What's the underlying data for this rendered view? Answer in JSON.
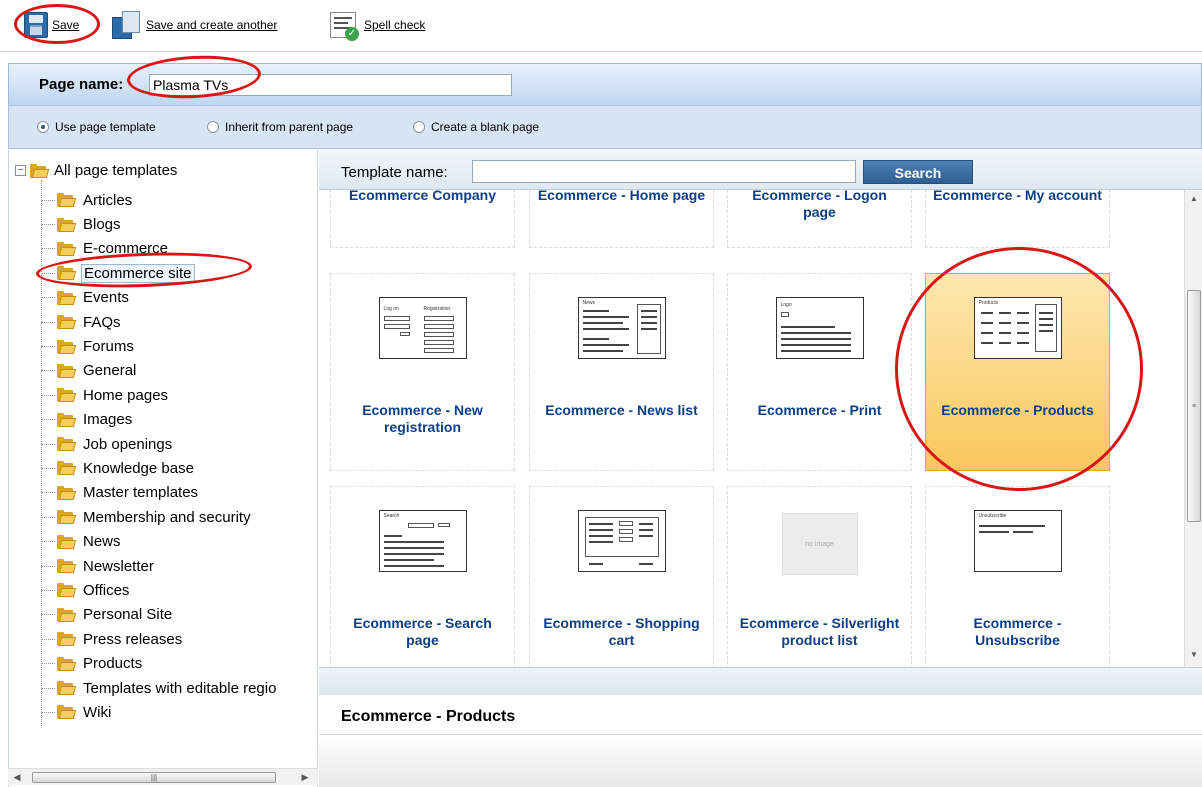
{
  "toolbar": {
    "save_label": "Save",
    "save_create_label": "Save and create another",
    "spell_label": "Spell check"
  },
  "page_name": {
    "label": "Page name:",
    "value": "Plasma TVs"
  },
  "template_options": [
    {
      "label": "Use page template",
      "selected": true
    },
    {
      "label": "Inherit from parent page",
      "selected": false
    },
    {
      "label": "Create a blank page",
      "selected": false
    }
  ],
  "tree": {
    "root_label": "All page templates",
    "items": [
      {
        "label": "Articles"
      },
      {
        "label": "Blogs"
      },
      {
        "label": "E-commerce"
      },
      {
        "label": "Ecommerce site",
        "selected": true
      },
      {
        "label": "Events"
      },
      {
        "label": "FAQs"
      },
      {
        "label": "Forums"
      },
      {
        "label": "General"
      },
      {
        "label": "Home pages"
      },
      {
        "label": "Images"
      },
      {
        "label": "Job openings"
      },
      {
        "label": "Knowledge base"
      },
      {
        "label": "Master templates"
      },
      {
        "label": "Membership and security"
      },
      {
        "label": "News"
      },
      {
        "label": "Newsletter"
      },
      {
        "label": "Offices"
      },
      {
        "label": "Personal Site"
      },
      {
        "label": "Press releases"
      },
      {
        "label": "Products"
      },
      {
        "label": "Templates with editable regio"
      },
      {
        "label": "Wiki"
      }
    ]
  },
  "search": {
    "label": "Template name:",
    "value": "",
    "button": "Search"
  },
  "templates": [
    {
      "name": "Ecommerce Company",
      "thumb": "none"
    },
    {
      "name": "Ecommerce - Home page",
      "thumb": "none"
    },
    {
      "name": "Ecommerce - Logon page",
      "thumb": "none"
    },
    {
      "name": "Ecommerce - My account",
      "thumb": "none"
    },
    {
      "name": "Ecommerce - New registration",
      "thumb": "registration"
    },
    {
      "name": "Ecommerce - News list",
      "thumb": "news"
    },
    {
      "name": "Ecommerce - Print",
      "thumb": "print"
    },
    {
      "name": "Ecommerce - Products",
      "thumb": "products",
      "selected": true
    },
    {
      "name": "Ecommerce - Search page",
      "thumb": "search"
    },
    {
      "name": "Ecommerce - Shopping cart",
      "thumb": "cart"
    },
    {
      "name": "Ecommerce - Silverlight product list",
      "thumb": "noimage"
    },
    {
      "name": "Ecommerce - Unsubscribe",
      "thumb": "unsubscribe"
    }
  ],
  "thumb_text": {
    "logon": "Log on",
    "registration": "Registration",
    "news": "News",
    "logo": "Logo",
    "products": "Products",
    "search": "Search",
    "unsubscribe": "Unsubscribe",
    "no_image": "no image"
  },
  "selected_template": "Ecommerce - Products",
  "colors": {
    "link_blue": "#0c3e86",
    "selection_orange": "#f9c75c",
    "annotation_red": "#d91515",
    "search_button": "#2d5f94"
  },
  "icons": [
    "save-icon",
    "save-and-create-icon",
    "spell-check-icon",
    "folder-icon",
    "collapse-icon"
  ]
}
